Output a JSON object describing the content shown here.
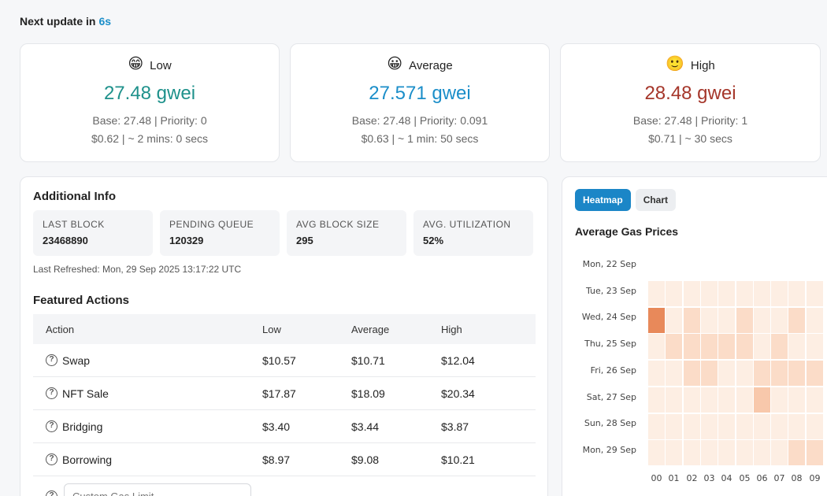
{
  "header": {
    "next_update_label": "Next update in",
    "next_update_value": "6s"
  },
  "cards": [
    {
      "emoji": "😁",
      "label": "Low",
      "price": "27.48 gwei",
      "details": "Base: 27.48 | Priority: 0",
      "cost_time": "$0.62 | ~ 2 mins: 0 secs",
      "color": "#1e918b"
    },
    {
      "emoji": "😀",
      "label": "Average",
      "price": "27.571 gwei",
      "details": "Base: 27.48 | Priority: 0.091",
      "cost_time": "$0.63 | ~ 1 min: 50 secs",
      "color": "#1b8ec9"
    },
    {
      "emoji": "🙂",
      "label": "High",
      "price": "28.48 gwei",
      "details": "Base: 27.48 | Priority: 1",
      "cost_time": "$0.71 | ~ 30 secs",
      "color": "#a5362a"
    }
  ],
  "additional_info": {
    "title": "Additional Info",
    "stats": [
      {
        "label": "LAST BLOCK",
        "value": "23468890"
      },
      {
        "label": "PENDING QUEUE",
        "value": "120329"
      },
      {
        "label": "AVG BLOCK SIZE",
        "value": "295"
      },
      {
        "label": "AVG. UTILIZATION",
        "value": "52%"
      }
    ],
    "last_refreshed": "Last Refreshed: Mon, 29 Sep 2025 13:17:22 UTC"
  },
  "featured_actions": {
    "title": "Featured Actions",
    "columns": [
      "Action",
      "Low",
      "Average",
      "High"
    ],
    "rows": [
      {
        "action": "Swap",
        "low": "$10.57",
        "average": "$10.71",
        "high": "$12.04"
      },
      {
        "action": "NFT Sale",
        "low": "$17.87",
        "average": "$18.09",
        "high": "$20.34"
      },
      {
        "action": "Bridging",
        "low": "$3.40",
        "average": "$3.44",
        "high": "$3.87"
      },
      {
        "action": "Borrowing",
        "low": "$8.97",
        "average": "$9.08",
        "high": "$10.21"
      }
    ],
    "custom_gas_placeholder": "Custom Gas Limit"
  },
  "heatmap_panel": {
    "tabs": [
      {
        "label": "Heatmap",
        "active": true
      },
      {
        "label": "Chart",
        "active": false
      }
    ],
    "title": "Average Gas Prices",
    "day_labels": [
      "Mon, 22 Sep",
      "Tue, 23 Sep",
      "Wed, 24 Sep",
      "Thu, 25 Sep",
      "Fri, 26 Sep",
      "Sat, 27 Sep",
      "Sun, 28 Sep",
      "Mon, 29 Sep"
    ],
    "hour_labels": [
      "00",
      "01",
      "02",
      "03",
      "04",
      "05",
      "06",
      "07",
      "08",
      "09"
    ],
    "colors": [
      "#fdeee3",
      "#fbdcc8",
      "#f8c8ab",
      "#e8895a"
    ],
    "intensity": [
      [
        0,
        0,
        0,
        0,
        0,
        0,
        0,
        0,
        0,
        0
      ],
      [
        3,
        0,
        1,
        0,
        0,
        1,
        0,
        0,
        1,
        0
      ],
      [
        0,
        1,
        1,
        1,
        1,
        1,
        0,
        1,
        0,
        0
      ],
      [
        0,
        0,
        1,
        1,
        0,
        0,
        1,
        1,
        1,
        1
      ],
      [
        0,
        0,
        0,
        0,
        0,
        0,
        2,
        0,
        0,
        0
      ],
      [
        0,
        0,
        0,
        0,
        0,
        0,
        0,
        0,
        0,
        0
      ],
      [
        0,
        0,
        0,
        0,
        0,
        0,
        0,
        0,
        1,
        1
      ]
    ]
  }
}
